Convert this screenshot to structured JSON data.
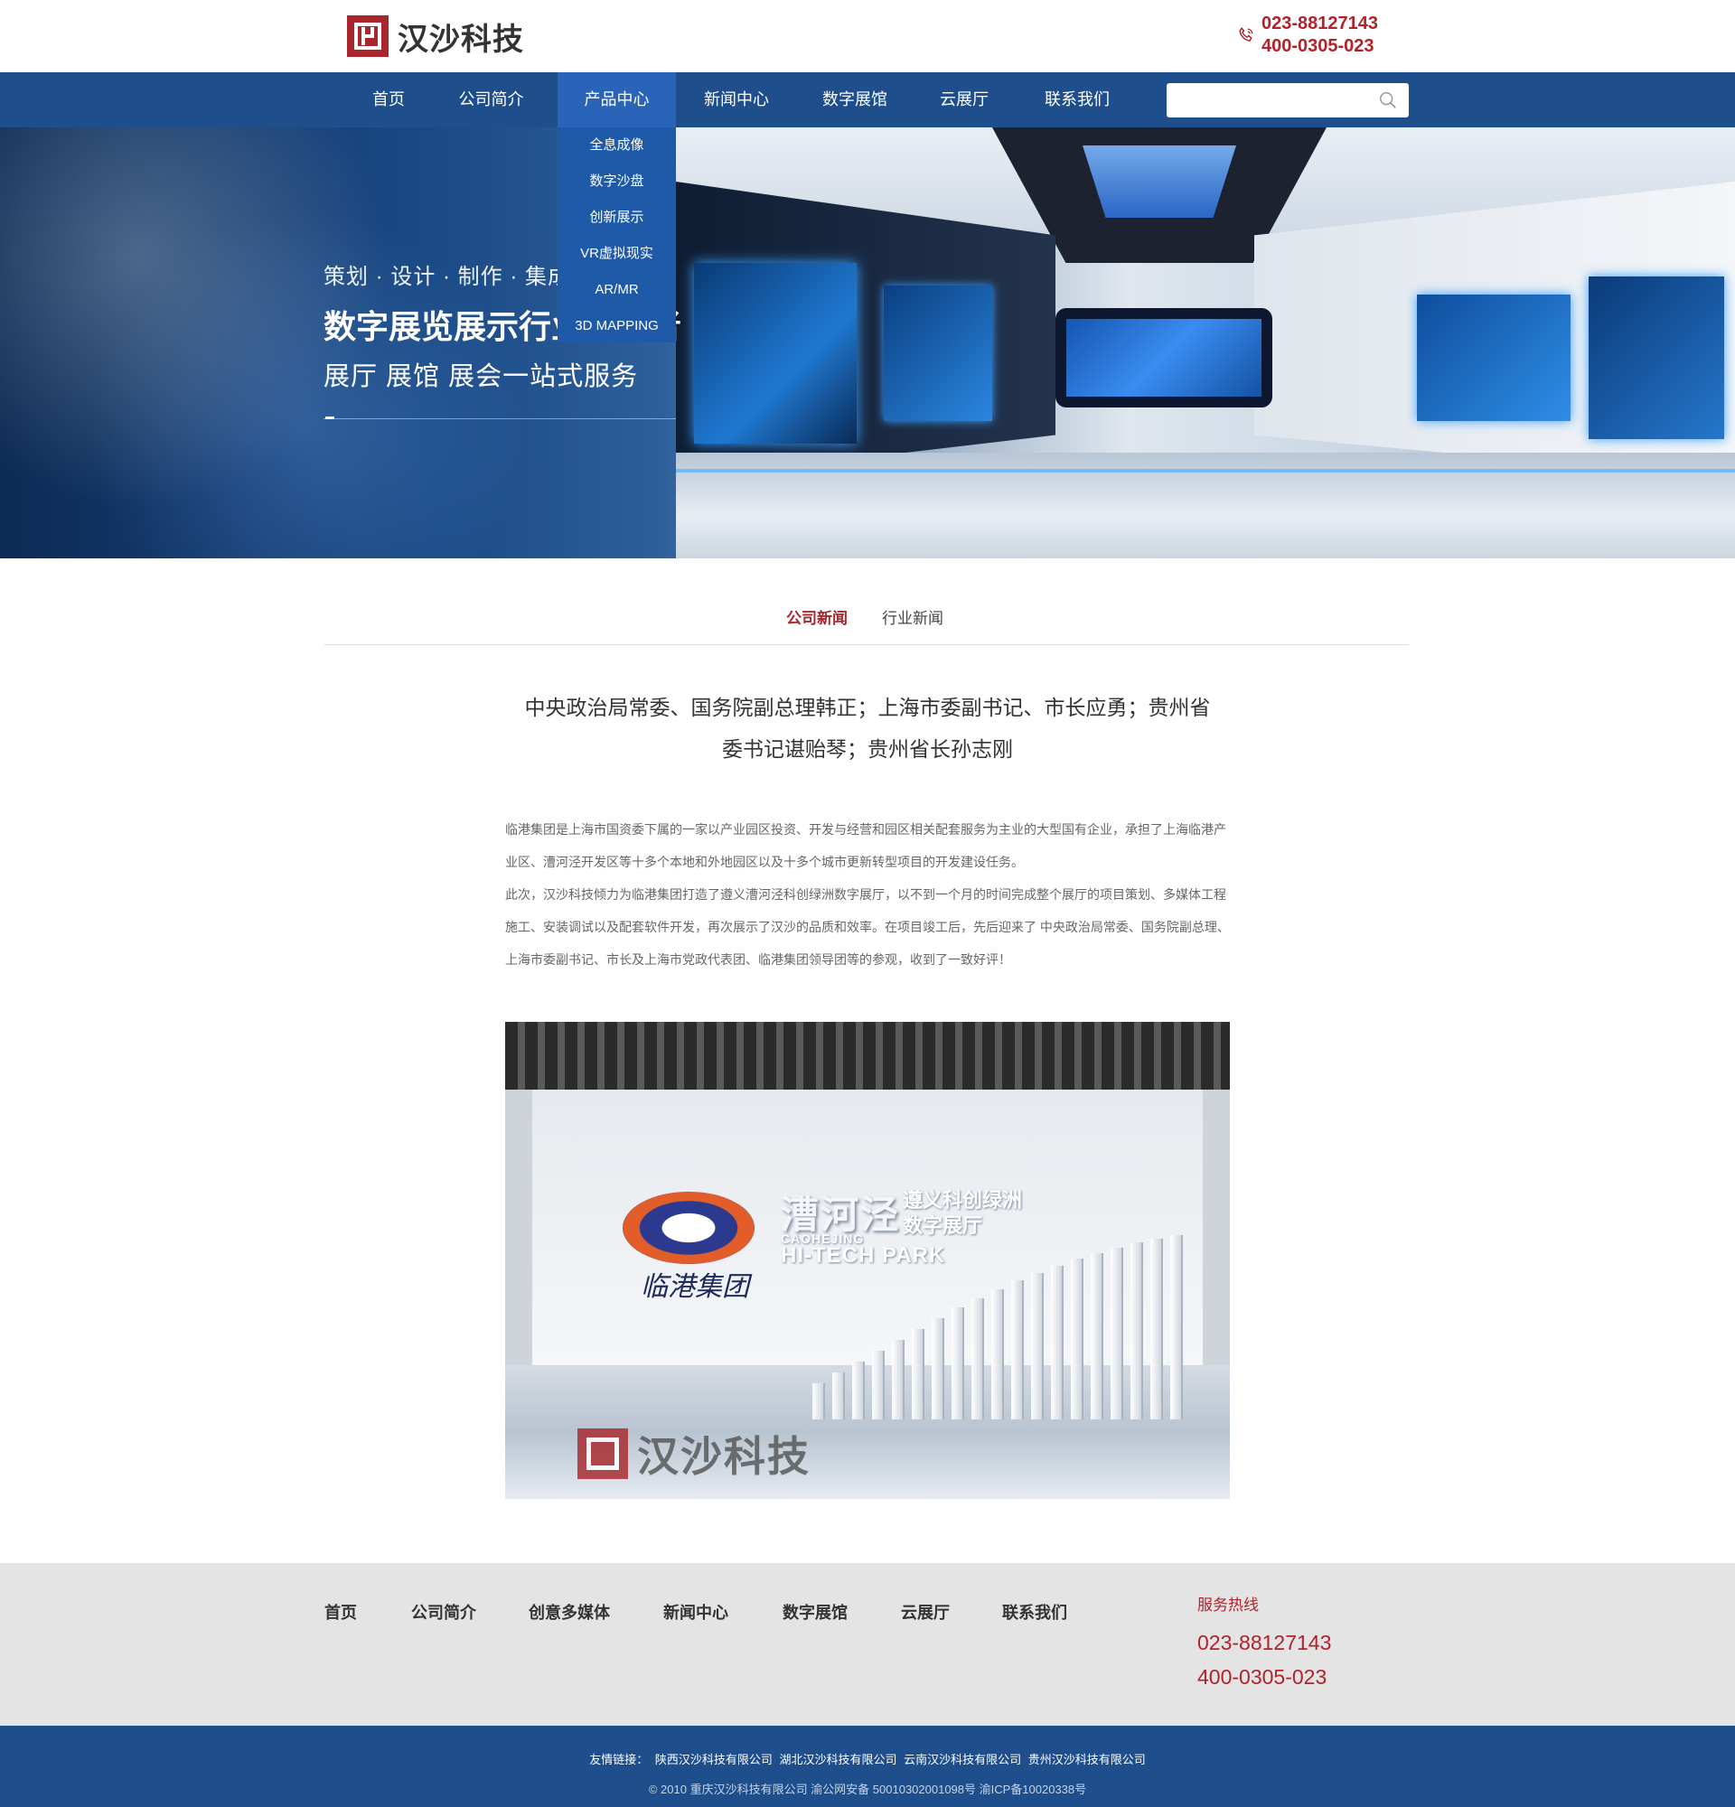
{
  "header": {
    "logo_text": "汉沙科技",
    "phone_1": "023-88127143",
    "phone_2": "400-0305-023"
  },
  "nav": {
    "items": [
      "首页",
      "公司简介",
      "产品中心",
      "新闻中心",
      "数字展馆",
      "云展厅",
      "联系我们"
    ],
    "active": "产品中心",
    "search_placeholder": ""
  },
  "dropdown": {
    "items": [
      "全息成像",
      "数字沙盘",
      "创新展示",
      "VR虚拟现实",
      "AR/MR",
      "3D MAPPING"
    ]
  },
  "banner": {
    "line1": "策划 · 设计 · 制作 · 集成 · 运营",
    "line2": "数字展览展示行业服务者",
    "line3": "展厅  展馆  展会一站式服务"
  },
  "tabs": {
    "items": [
      "公司新闻",
      "行业新闻"
    ],
    "active": "公司新闻"
  },
  "article": {
    "title_1": "中央政治局常委、国务院副总理韩正；上海市委副书记、市长应勇；贵州省",
    "title_2": "委书记谌贻琴；贵州省长孙志刚",
    "body_1": "临港集团是上海市国资委下属的一家以产业园区投资、开发与经营和园区相关配套服务为主业的大型国有企业，承担了上海临港产业区、漕河泾开发区等十多个本地和外地园区以及十多个城市更新转型项目的开发建设任务。",
    "body_2": "此次，汉沙科技倾力为临港集团打造了遵义漕河泾科创绿洲数字展厅，以不到一个月的时间完成整个展厅的项目策划、多媒体工程施工、安装调试以及配套软件开发，再次展示了汉沙的品质和效率。在项目竣工后，先后迎来了 中央政治局常委、国务院副总理、上海市委副书记、市长及上海市党政代表团、临港集团领导团等的参观，收到了一致好评！",
    "photo": {
      "brand_cn": "漕河泾",
      "brand_sub1": "遵义科创绿洲",
      "brand_sub2": "数字展厅",
      "brand_en1": "CAOHEJING",
      "brand_en2": "HI-TECH PARK",
      "group_cn": "临港集团",
      "watermark": "汉沙科技"
    }
  },
  "footer": {
    "links": [
      "首页",
      "公司简介",
      "创意多媒体",
      "新闻中心",
      "数字展馆",
      "云展厅",
      "联系我们"
    ],
    "service_label": "服务热线",
    "service_phone_1": "023-88127143",
    "service_phone_2": "400-0305-023",
    "friend_label": "友情链接：",
    "friend_links": [
      "陕西汉沙科技有限公司",
      "湖北汉沙科技有限公司",
      "云南汉沙科技有限公司",
      "贵州汉沙科技有限公司"
    ],
    "copyright": "© 2010 重庆汉沙科技有限公司  渝公网安备 50010302001098号 渝ICP备10020338号"
  },
  "colors": {
    "nav_blue": "#1e4e8c",
    "dropdown_blue": "#1f5aa8",
    "brand_red": "#a8272d",
    "footer_gray": "#e4e4e4"
  },
  "icons": [
    "phone-icon",
    "search-icon",
    "logo-mark-icon"
  ]
}
